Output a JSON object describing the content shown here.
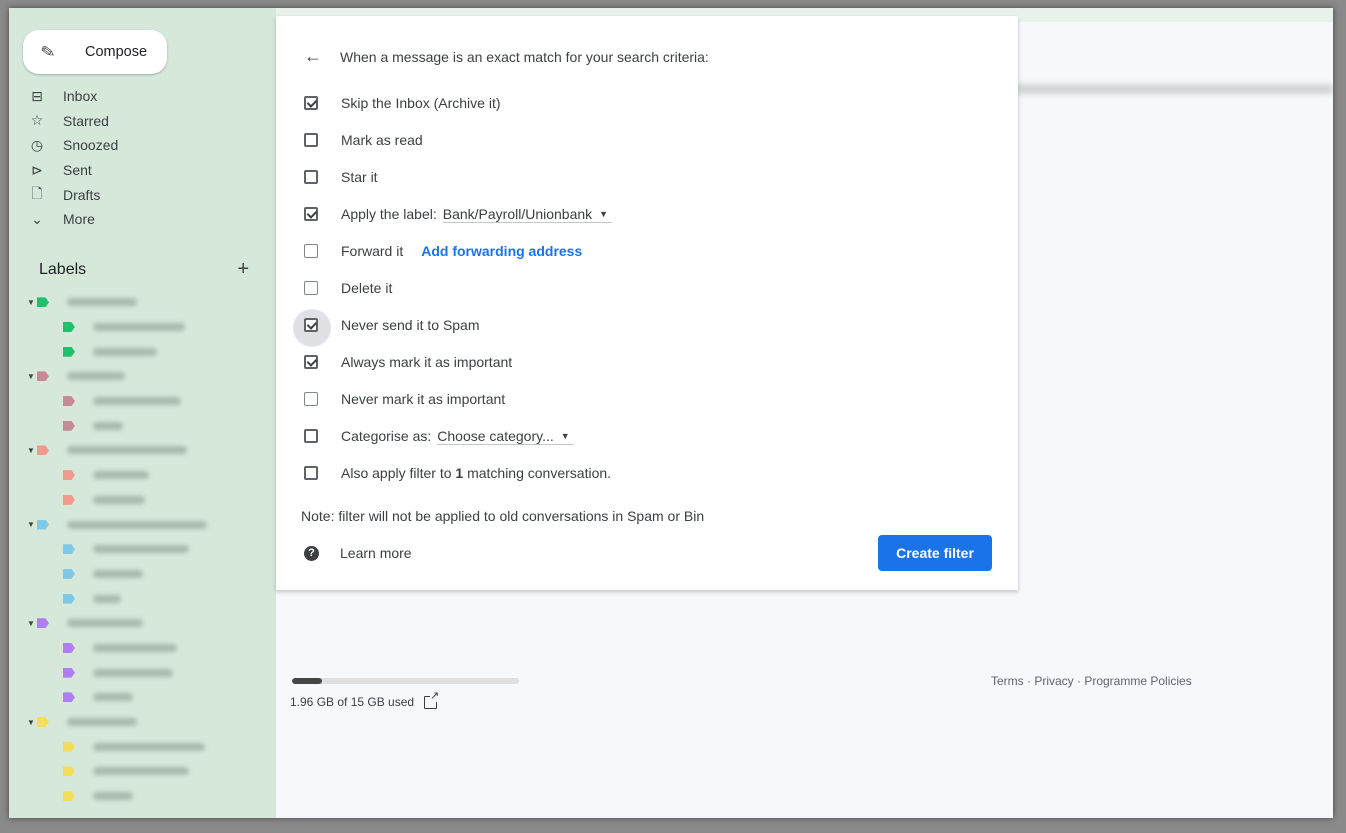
{
  "compose": {
    "label": "Compose",
    "icon": "pencil-icon"
  },
  "nav": [
    {
      "label": "Inbox",
      "icon": "inbox-icon",
      "glyph": "⊟"
    },
    {
      "label": "Starred",
      "icon": "star-icon",
      "glyph": "☆"
    },
    {
      "label": "Snoozed",
      "icon": "clock-icon",
      "glyph": "◷"
    },
    {
      "label": "Sent",
      "icon": "send-icon",
      "glyph": "⊳"
    },
    {
      "label": "Drafts",
      "icon": "draft-icon",
      "glyph": "🗋"
    },
    {
      "label": "More",
      "icon": "chevron-down-icon",
      "glyph": "⌄"
    }
  ],
  "labels": {
    "title": "Labels",
    "add_glyph": "+",
    "items": [
      {
        "color": "#1fc26b",
        "parent": true
      },
      {
        "color": "#1fc26b",
        "parent": false
      },
      {
        "color": "#1fc26b",
        "parent": false
      },
      {
        "color": "#c58a95",
        "parent": true
      },
      {
        "color": "#c58a95",
        "parent": false
      },
      {
        "color": "#c58a95",
        "parent": false
      },
      {
        "color": "#f29a8c",
        "parent": true
      },
      {
        "color": "#f29a8c",
        "parent": false
      },
      {
        "color": "#f29a8c",
        "parent": false
      },
      {
        "color": "#7fc9e8",
        "parent": true
      },
      {
        "color": "#7fc9e8",
        "parent": false
      },
      {
        "color": "#7fc9e8",
        "parent": false
      },
      {
        "color": "#7fc9e8",
        "parent": false
      },
      {
        "color": "#b07ef0",
        "parent": true
      },
      {
        "color": "#b07ef0",
        "parent": false
      },
      {
        "color": "#b07ef0",
        "parent": false
      },
      {
        "color": "#b07ef0",
        "parent": false
      },
      {
        "color": "#f5dd5c",
        "parent": true
      },
      {
        "color": "#f5dd5c",
        "parent": false
      },
      {
        "color": "#f5dd5c",
        "parent": false
      },
      {
        "color": "#f5dd5c",
        "parent": false
      }
    ]
  },
  "filter": {
    "header": "When a message is an exact match for your search criteria:",
    "options": {
      "skip_inbox": {
        "label": "Skip the Inbox (Archive it)",
        "checked": true
      },
      "mark_read": {
        "label": "Mark as read",
        "checked": false
      },
      "star": {
        "label": "Star it",
        "checked": false
      },
      "apply_label": {
        "label": "Apply the label:",
        "value": "Bank/Payroll/Unionbank",
        "checked": true
      },
      "forward": {
        "label": "Forward it",
        "link": "Add forwarding address",
        "checked": false
      },
      "delete": {
        "label": "Delete it",
        "checked": false
      },
      "never_spam": {
        "label": "Never send it to Spam",
        "checked": true
      },
      "always_important": {
        "label": "Always mark it as important",
        "checked": true
      },
      "never_important": {
        "label": "Never mark it as important",
        "checked": false
      },
      "categorise": {
        "label": "Categorise as:",
        "value": "Choose category...",
        "checked": false
      },
      "also_apply_pre": "Also apply filter to ",
      "also_apply_count": "1",
      "also_apply_post": " matching conversation."
    },
    "note": "Note: filter will not be applied to old conversations in Spam or Bin",
    "learn_more": "Learn more",
    "create_button": "Create filter"
  },
  "storage": {
    "text": "1.96 GB of 15 GB used",
    "used_fraction": 0.131
  },
  "footer": "Terms · Privacy · Programme Policies",
  "colors": {
    "accent": "#1a73e8",
    "sidebar": "#d5e8da"
  }
}
